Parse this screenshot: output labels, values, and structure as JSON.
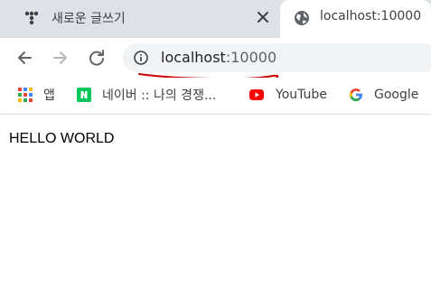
{
  "tabs": [
    {
      "title": "새로운 글쓰기",
      "icon": "dots-logo-icon",
      "active": false
    },
    {
      "title": "localhost:10000",
      "icon": "globe-icon",
      "active": true
    }
  ],
  "toolbar": {
    "url_host": "localhost",
    "url_port": ":10000"
  },
  "bookmarks": [
    {
      "label": "앱",
      "icon": "apps-grid-icon"
    },
    {
      "label": "네이버 :: 나의 경쟁...",
      "icon": "naver-icon"
    },
    {
      "label": "YouTube",
      "icon": "youtube-icon"
    },
    {
      "label": "Google",
      "icon": "google-icon"
    }
  ],
  "page": {
    "text": "HELLO WORLD"
  },
  "colors": {
    "tabbar_bg": "#dee1e6",
    "omnibox_bg": "#f1f3f4",
    "annotation": "#cc0000",
    "naver": "#03c75a",
    "youtube": "#ff0000"
  }
}
